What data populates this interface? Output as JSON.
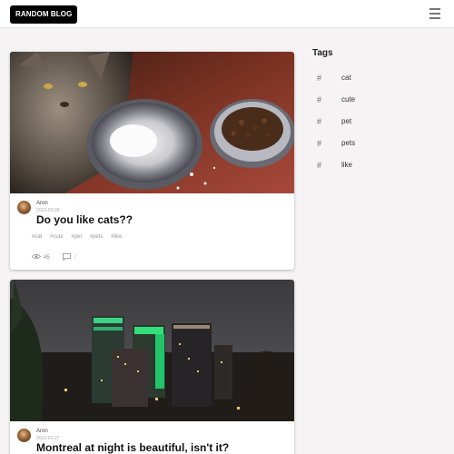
{
  "header": {
    "brand": "RANDOM BLOG",
    "menu_icon": "hamburger-menu-icon"
  },
  "posts": [
    {
      "author": "Aron",
      "date": "2023-02-09",
      "title": "Do you like cats??",
      "tags": [
        "#cat",
        "#cute",
        "#pet",
        "#pets",
        "#like"
      ],
      "views": "45",
      "comments": "7"
    },
    {
      "author": "Aron",
      "date": "2023-02-27",
      "title": "Montreal at night is beautiful, isn't it?"
    }
  ],
  "sidebar": {
    "title": "Tags",
    "tags": [
      "cat",
      "cute",
      "pet",
      "pets",
      "like"
    ],
    "tag_icon": "hash-icon"
  },
  "colors": {
    "brand_bg": "#000000",
    "page_bg": "#f5f3f4",
    "card_bg": "#ffffff"
  }
}
